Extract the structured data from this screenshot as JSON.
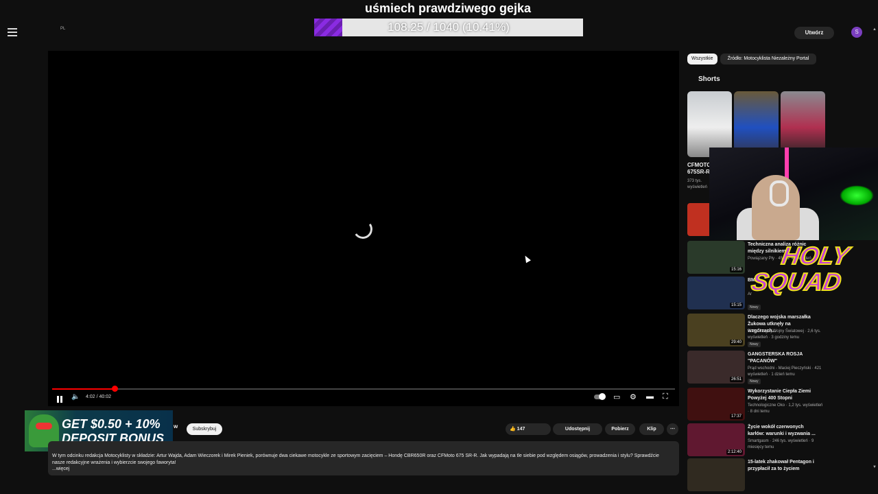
{
  "overlay": {
    "goal_title": "uśmiech prawdziwego gejka",
    "goal_progress": "108.25 / 1040 (10.41%)",
    "goal_fraction": 0.1041,
    "fill_color": "#8a2be2"
  },
  "masthead": {
    "menu_icon": "hamburger-menu-icon",
    "country_code": "PL",
    "create_label": "Utwórz",
    "avatar_letter": "S"
  },
  "player": {
    "state": "loading",
    "time": "4:02 / 40:02",
    "played_fraction": 0.1,
    "progress_color": "#ff0000"
  },
  "ad": {
    "line1": "GET $0.50 + 10%",
    "line2": "DEPOSIT BONUS"
  },
  "video": {
    "channel_fragment": "w",
    "subscribe_label": "Subskrybuj",
    "like_count": "147",
    "share_label": "Udostępnij",
    "download_label": "Pobierz",
    "clip_label": "Klip",
    "more_label": "⋯",
    "description": "W tym odcinku redakcja Motocyklisty w składzie: Artur Wajda, Adam Wieczorek i Mirek Pieniek, porównuje dwa ciekawe motocykle ze sportowym zacięciem – Hondę CBR650R oraz CFMoto 675 SR-R. Jak wypadają na tle siebie pod względem osiągów, prowadzenia i stylu? Sprawdźcie nasze redakcyjne wrażenia i wybierzcie swojego faworyta!",
    "description_more": "...więcej"
  },
  "sidebar": {
    "chips": [
      "Wszystkie",
      "Źródło: Motocyklista Niezależny Portal"
    ],
    "shorts_heading": "Shorts",
    "short_title": "CFMOTO 675SR-R",
    "short_views": "373 tys. wyświetleń",
    "videos": [
      {
        "title": "",
        "meta": "",
        "duration": "",
        "color": "#c03020"
      },
      {
        "title": "Techniczna analiza różnic między silnikiem",
        "meta": "Powiązany Pły · 45 tys. wyświetleń",
        "duration": "15:16",
        "color": "#2a3a2a"
      },
      {
        "title": "BM",
        "meta": "Ar",
        "duration": "15:15",
        "badge": "Nowy",
        "color": "#203050"
      },
      {
        "title": "Dlaczego wojska marszałka Żukowa utknęły na wzgórzach...",
        "meta": "Bitwy Drugiej Wojny Światowej · 2,6 tys. wyświetleń · 3 godziny temu",
        "duration": "29:40",
        "badge": "Nowy",
        "color": "#4a4020"
      },
      {
        "title": "GANGSTERSKA ROSJA \"PACANÓW\"",
        "meta": "Prąd wschodni - Maciej Pieczyński · 421 wyświetleń · 1 dzień temu",
        "duration": "26:51",
        "badge": "Nowy",
        "color": "#3a2a2a"
      },
      {
        "title": "Wykorzystanie Ciepła Ziemi Powyżej 400 Stopni",
        "meta": "Technologiczne Oko · 1,2 tys. wyświetleń · 8 dni temu",
        "duration": "17:37",
        "color": "#401010"
      },
      {
        "title": "Życie wokół czerwonych karłów: warunki i wyzwania ...",
        "meta": "Smartgasm · 246 tys. wyświetleń · 9 miesięcy temu",
        "duration": "2:12:40",
        "color": "#601830"
      },
      {
        "title": "15-latek zhakował Pentagon i przypłacił za to życiem",
        "meta": "",
        "duration": "",
        "color": "#302a20"
      }
    ]
  },
  "stream_overlay": {
    "logo_line1": "HOLY",
    "logo_line2": "SQUAD"
  }
}
